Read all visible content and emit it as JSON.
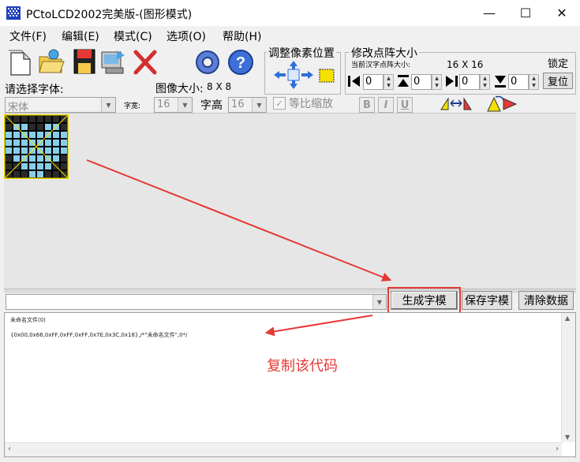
{
  "window": {
    "title": "PCtoLCD2002完美版-(图形模式)",
    "minimize_glyph": "—",
    "maximize_glyph": "☐",
    "close_glyph": "✕"
  },
  "menu": [
    "文件(F)",
    "编辑(E)",
    "模式(C)",
    "选项(O)",
    "帮助(H)"
  ],
  "toolbar": {
    "icons": [
      "new-file-icon",
      "open-folder-icon",
      "save-disk-icon",
      "import-image-icon",
      "delete-x-icon",
      "settings-gear-icon",
      "help-icon"
    ]
  },
  "font_panel": {
    "select_font_label": "请选择字体:",
    "font_value": "宋体",
    "char_width_label": "字宽:",
    "char_width_value": "16",
    "char_height_label": "字高",
    "char_height_value": "16",
    "proportional_label": "等比缩放",
    "bold": "B",
    "italic": "I",
    "underline": "U"
  },
  "image_size": {
    "label": "图像大小:",
    "value": "8 X 8"
  },
  "pixel_adjust": {
    "title": "调整像素位置"
  },
  "matrix_panel": {
    "title": "修改点阵大小",
    "current_label": "当前汉字点阵大小:",
    "current_value": "16 X 16",
    "lock_label": "锁定",
    "reset_label": "复位",
    "spin_values": [
      "0",
      "0",
      "0",
      "0"
    ]
  },
  "buttons": {
    "generate": "生成字模",
    "save": "保存字模",
    "clear": "清除数据"
  },
  "output": {
    "line1": "未命名文件(0)",
    "line2": "{0x00,0x66,0xFF,0xFF,0xFF,0x7E,0x3C,0x18},/*\"未命名文件\",0*/"
  },
  "annotation": {
    "text": "复制该代码",
    "color": "#e53935"
  },
  "pixel_grid": {
    "rows": [
      [
        0,
        0,
        0,
        0,
        0,
        0,
        0,
        0
      ],
      [
        0,
        1,
        1,
        0,
        0,
        1,
        1,
        0
      ],
      [
        1,
        1,
        1,
        1,
        1,
        1,
        1,
        1
      ],
      [
        1,
        1,
        1,
        1,
        1,
        1,
        1,
        1
      ],
      [
        1,
        1,
        1,
        1,
        1,
        1,
        1,
        1
      ],
      [
        0,
        1,
        1,
        1,
        1,
        1,
        1,
        0
      ],
      [
        0,
        0,
        1,
        1,
        1,
        1,
        0,
        0
      ],
      [
        0,
        0,
        0,
        1,
        1,
        0,
        0,
        0
      ]
    ],
    "on_color": "#87ceeb",
    "off_color": "#2a2a2a",
    "border_color": "#f5e100"
  }
}
